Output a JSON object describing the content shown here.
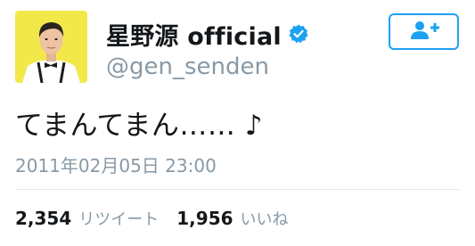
{
  "tweet": {
    "display_name": "星野源 official",
    "handle": "@gen_senden",
    "text": "てまんてまん…… ♪",
    "timestamp": "2011年02月05日 23:00",
    "retweets_count": "2,354",
    "retweets_label": "リツイート",
    "likes_count": "1,956",
    "likes_label": "いいね"
  },
  "icons": {
    "verified": "verified-badge-icon",
    "follow": "add-person-icon"
  },
  "colors": {
    "accent": "#1da1f2",
    "text_primary": "#14171a",
    "text_secondary": "#8899a6",
    "avatar_bg": "#f3e84a",
    "divider": "#e1e8ed"
  }
}
